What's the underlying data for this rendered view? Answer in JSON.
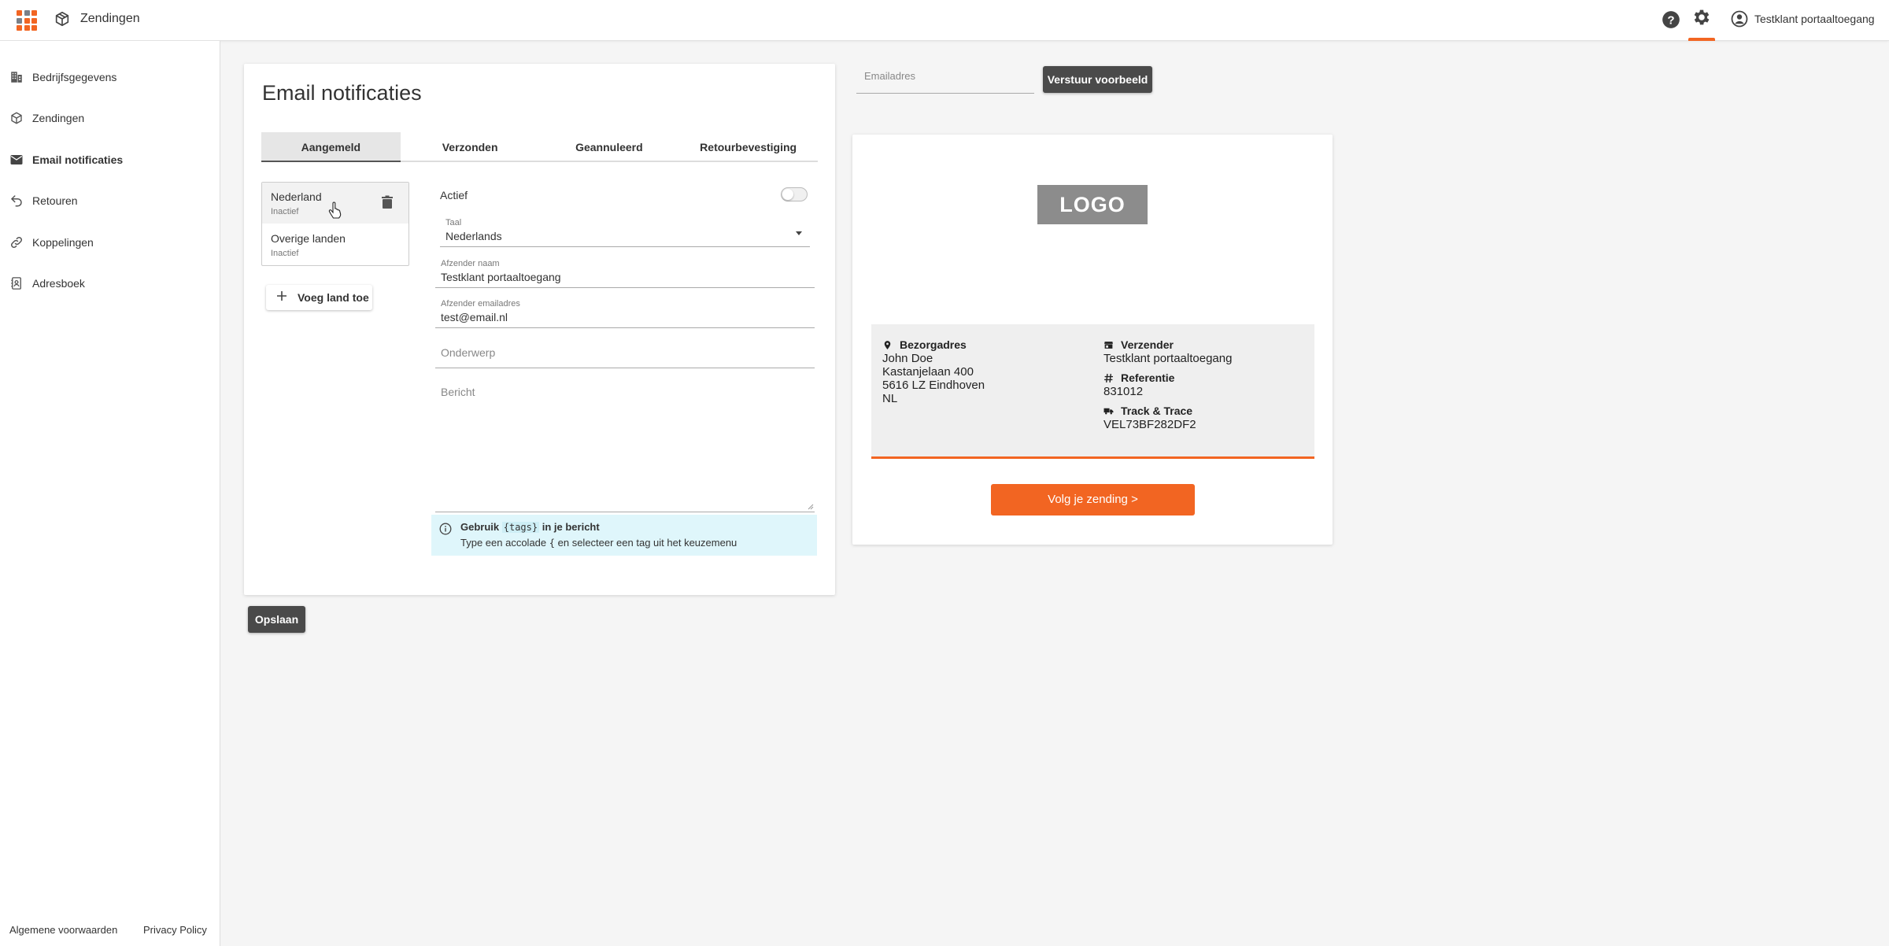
{
  "topbar": {
    "app_title": "Zendingen",
    "user_name": "Testklant portaaltoegang",
    "grid_colors": [
      "#f26522",
      "#7a8088",
      "#f26522",
      "#7a8088",
      "#f26522",
      "#f26522",
      "#f26522",
      "#f26522",
      "#f26522"
    ]
  },
  "sidebar": {
    "items": [
      {
        "label": "Bedrijfsgegevens",
        "icon": "building-icon"
      },
      {
        "label": "Zendingen",
        "icon": "package-icon"
      },
      {
        "label": "Email notificaties",
        "icon": "mail-icon"
      },
      {
        "label": "Retouren",
        "icon": "return-arrow-icon"
      },
      {
        "label": "Koppelingen",
        "icon": "link-icon"
      },
      {
        "label": "Adresboek",
        "icon": "address-book-icon"
      }
    ],
    "footer_terms": "Algemene voorwaarden",
    "footer_privacy": "Privacy Policy"
  },
  "main": {
    "title": "Email notificaties",
    "tabs": [
      {
        "label": "Aangemeld",
        "active": true
      },
      {
        "label": "Verzonden"
      },
      {
        "label": "Geannuleerd"
      },
      {
        "label": "Retourbevestiging"
      }
    ],
    "countries": [
      {
        "name": "Nederland",
        "status": "Inactief"
      },
      {
        "name": "Overige landen",
        "status": "Inactief"
      }
    ],
    "add_country_label": "Voeg land toe",
    "form": {
      "actief_label": "Actief",
      "actief_on": false,
      "taal_label": "Taal",
      "taal_value": "Nederlands",
      "afzender_naam_label": "Afzender naam",
      "afzender_naam_value": "Testklant portaaltoegang",
      "afzender_email_label": "Afzender emailadres",
      "afzender_email_value": "test@email.nl",
      "onderwerp_placeholder": "Onderwerp",
      "bericht_placeholder": "Bericht"
    },
    "info": {
      "line1_pre": "Gebruik",
      "line1_tag": "{tags}",
      "line1_post": "in je bericht",
      "line2_pre": "Type een accolade",
      "line2_code": "{",
      "line2_post": "en selecteer een tag uit het keuzemenu"
    },
    "save_label": "Opslaan"
  },
  "preview": {
    "email_placeholder": "Emailadres",
    "send_button_label": "Verstuur voorbeeld",
    "logo_text": "LOGO",
    "bezorgadres_label": "Bezorgadres",
    "address_lines": [
      "John Doe",
      "Kastanjelaan 400",
      "5616 LZ Eindhoven",
      "NL"
    ],
    "verzender_label": "Verzender",
    "verzender_value": "Testklant portaaltoegang",
    "referentie_label": "Referentie",
    "referentie_value": "831012",
    "track_label": "Track & Trace",
    "track_value": "VEL73BF282DF2",
    "track_button_label": "Volg je zending >",
    "accent_color": "#f26522"
  }
}
